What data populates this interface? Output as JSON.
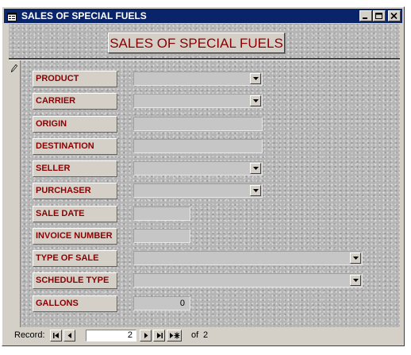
{
  "window": {
    "title": "SALES OF SPECIAL FUELS",
    "title_bar_color": "#0a246a"
  },
  "form": {
    "heading": "SALES OF SPECIAL FUELS",
    "label_color": "#8b0000",
    "fields": [
      {
        "label": "PRODUCT",
        "value": "",
        "control": "combo"
      },
      {
        "label": "CARRIER",
        "value": "",
        "control": "combo"
      },
      {
        "label": "ORIGIN",
        "value": "",
        "control": "text"
      },
      {
        "label": "DESTINATION",
        "value": "",
        "control": "text"
      },
      {
        "label": "SELLER",
        "value": "",
        "control": "combo"
      },
      {
        "label": "PURCHASER",
        "value": "",
        "control": "combo"
      },
      {
        "label": "SALE DATE",
        "value": "",
        "control": "text"
      },
      {
        "label": "INVOICE NUMBER",
        "value": "",
        "control": "text"
      },
      {
        "label": "TYPE OF SALE",
        "value": "",
        "control": "combo"
      },
      {
        "label": "SCHEDULE TYPE",
        "value": "",
        "control": "combo"
      },
      {
        "label": "GALLONS",
        "value": "0",
        "control": "text"
      }
    ]
  },
  "navigation": {
    "record_label": "Record:",
    "current_record": "2",
    "of_label": "of",
    "total_records": "2",
    "icons": [
      "first-record-icon",
      "previous-record-icon",
      "next-record-icon",
      "last-record-icon",
      "new-record-icon"
    ]
  },
  "icons": {
    "window": "form-icon",
    "selector": "pencil-icon",
    "controls": [
      "minimize-icon",
      "maximize-icon",
      "close-icon"
    ]
  }
}
